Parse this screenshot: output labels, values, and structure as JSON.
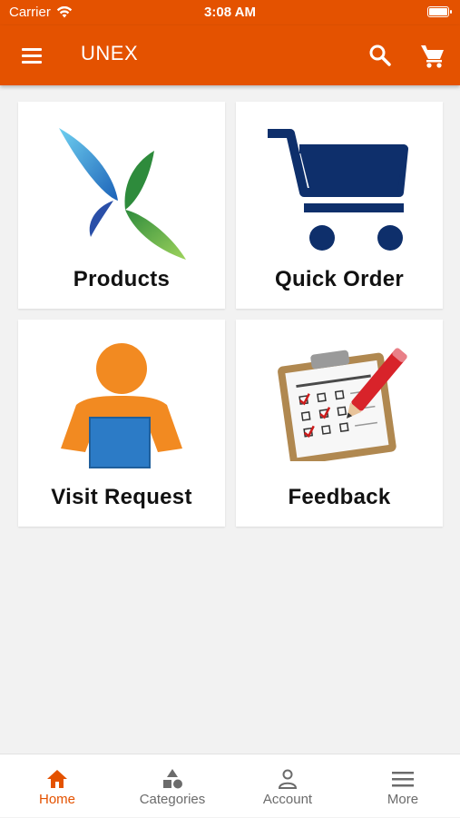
{
  "status_bar": {
    "carrier": "Carrier",
    "time": "3:08 AM"
  },
  "app_bar": {
    "title": "UNEX",
    "icons": [
      "menu-icon",
      "search-icon",
      "cart-icon"
    ]
  },
  "tiles": [
    {
      "label": "Products",
      "icon": "butterfly-logo-icon"
    },
    {
      "label": "Quick Order",
      "icon": "shopping-cart-icon"
    },
    {
      "label": "Visit Request",
      "icon": "person-laptop-icon"
    },
    {
      "label": "Feedback",
      "icon": "survey-clipboard-icon"
    }
  ],
  "tab_bar": {
    "active": "Home",
    "items": [
      {
        "label": "Home",
        "icon": "home-icon"
      },
      {
        "label": "Categories",
        "icon": "shapes-icon"
      },
      {
        "label": "Account",
        "icon": "person-icon"
      },
      {
        "label": "More",
        "icon": "menu-icon"
      }
    ]
  },
  "colors": {
    "brand": "#e45200",
    "background": "#f2f2f2",
    "tile": "#ffffff",
    "tab_inactive": "#6b6b6b"
  }
}
